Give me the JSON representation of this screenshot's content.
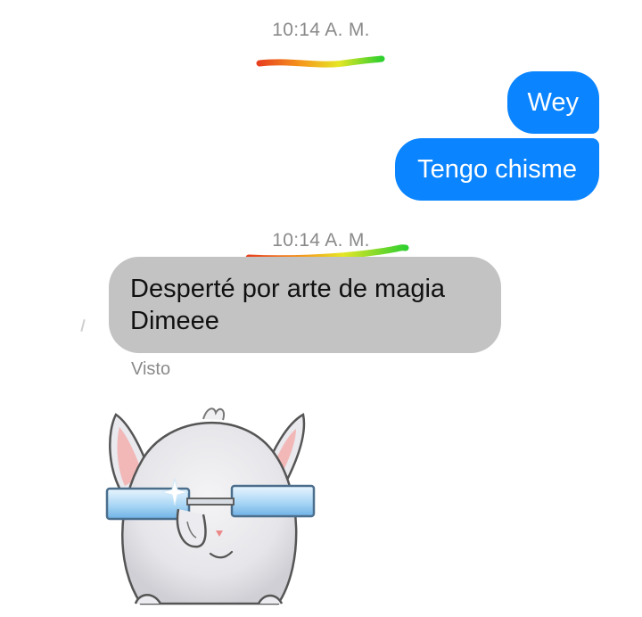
{
  "conversation": {
    "timestamps": [
      "10:14 A. M.",
      "10:14 A. M."
    ],
    "outgoing_messages": [
      "Wey",
      "Tengo chisme"
    ],
    "incoming_message": {
      "lines": [
        "Desperté por arte de magia",
        "Dimeee"
      ]
    },
    "seen_label": "Visto"
  },
  "sticker": {
    "icon": "bunny-with-glasses-sticker-icon"
  },
  "colors": {
    "outgoing_bubble": "#0a84ff",
    "incoming_bubble": "#c3c3c3",
    "meta_text": "#8a8a8a"
  }
}
